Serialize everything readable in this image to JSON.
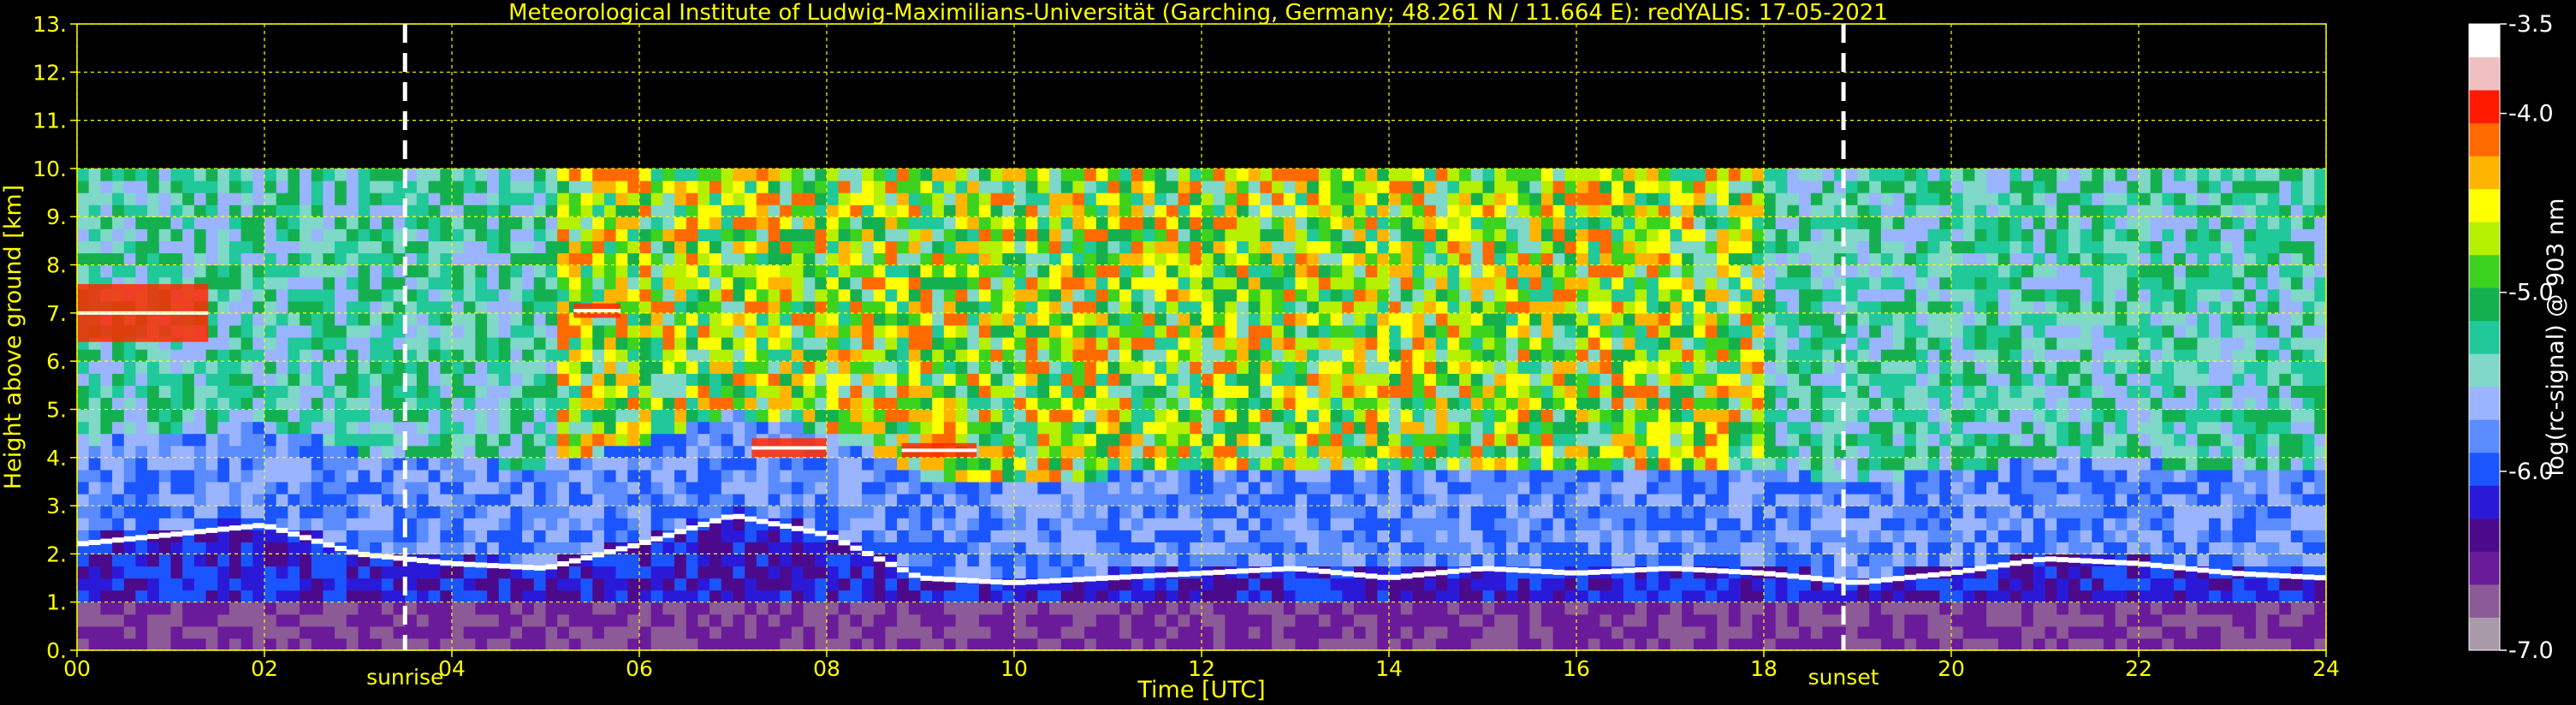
{
  "chart_data": {
    "type": "heatmap",
    "title": "Meteorological Institute of Ludwig-Maximilians-Universität (Garching, Germany; 48.261 N / 11.664 E):    redYALIS: 17-05-2021",
    "xlabel": "Time [UTC]",
    "ylabel": "Height above ground [km]",
    "xlim": [
      0,
      24
    ],
    "ylim": [
      0,
      13
    ],
    "x_ticks": [
      "00",
      "02",
      "04",
      "06",
      "08",
      "10",
      "12",
      "14",
      "16",
      "18",
      "20",
      "22",
      "24"
    ],
    "y_ticks": [
      "0.",
      "1.",
      "2.",
      "3.",
      "4.",
      "5.",
      "6.",
      "7.",
      "8.",
      "9.",
      "10.",
      "11.",
      "12.",
      "13."
    ],
    "grid": true,
    "data_top_km": 10,
    "colorbar": {
      "label": "log(rc-signal) @ 903 nm",
      "range": [
        -7.0,
        -3.5
      ],
      "ticks": [
        "-3.5",
        "-4.0",
        "-5.0",
        "-6.0",
        "-7.0"
      ]
    },
    "markers": [
      {
        "label": "sunrise",
        "time_utc": 3.5
      },
      {
        "label": "sunset",
        "time_utc": 18.85
      }
    ],
    "boundary_layer_top_km": [
      [
        0,
        2.2
      ],
      [
        1,
        2.4
      ],
      [
        2,
        2.6
      ],
      [
        3,
        2.0
      ],
      [
        4,
        1.8
      ],
      [
        5,
        1.7
      ],
      [
        6,
        2.2
      ],
      [
        7,
        2.8
      ],
      [
        8,
        2.4
      ],
      [
        9,
        1.5
      ],
      [
        10,
        1.4
      ],
      [
        11,
        1.5
      ],
      [
        12,
        1.6
      ],
      [
        13,
        1.7
      ],
      [
        14,
        1.5
      ],
      [
        15,
        1.7
      ],
      [
        16,
        1.6
      ],
      [
        17,
        1.7
      ],
      [
        18,
        1.6
      ],
      [
        19,
        1.4
      ],
      [
        20,
        1.6
      ],
      [
        21,
        1.9
      ],
      [
        22,
        1.8
      ],
      [
        23,
        1.6
      ],
      [
        24,
        1.5
      ]
    ],
    "cloud_layers": [
      {
        "start_utc": 0.0,
        "end_utc": 1.4,
        "base_km": 6.4,
        "top_km": 7.6
      },
      {
        "start_utc": 5.3,
        "end_utc": 5.8,
        "base_km": 6.9,
        "top_km": 7.2
      },
      {
        "start_utc": 7.2,
        "end_utc": 8.0,
        "base_km": 4.0,
        "top_km": 4.4
      },
      {
        "start_utc": 8.8,
        "end_utc": 9.6,
        "base_km": 4.0,
        "top_km": 4.3
      }
    ],
    "colors": {
      "background": "#000000",
      "text": "#ffff00",
      "grid": "#ffff00",
      "marker_line": "#ffffff",
      "colorbar_text": "#ffffff",
      "colorscale": [
        "#a89aa8",
        "#8c5a96",
        "#6a1b9a",
        "#4b0a8c",
        "#2a1ad8",
        "#1b55ff",
        "#5a8cff",
        "#9ab4ff",
        "#7fd8c8",
        "#20c89a",
        "#14b050",
        "#3cd21e",
        "#b4f000",
        "#ffff00",
        "#ffb400",
        "#ff6a00",
        "#ff1a00",
        "#f0c0c0",
        "#ffffff"
      ]
    }
  }
}
